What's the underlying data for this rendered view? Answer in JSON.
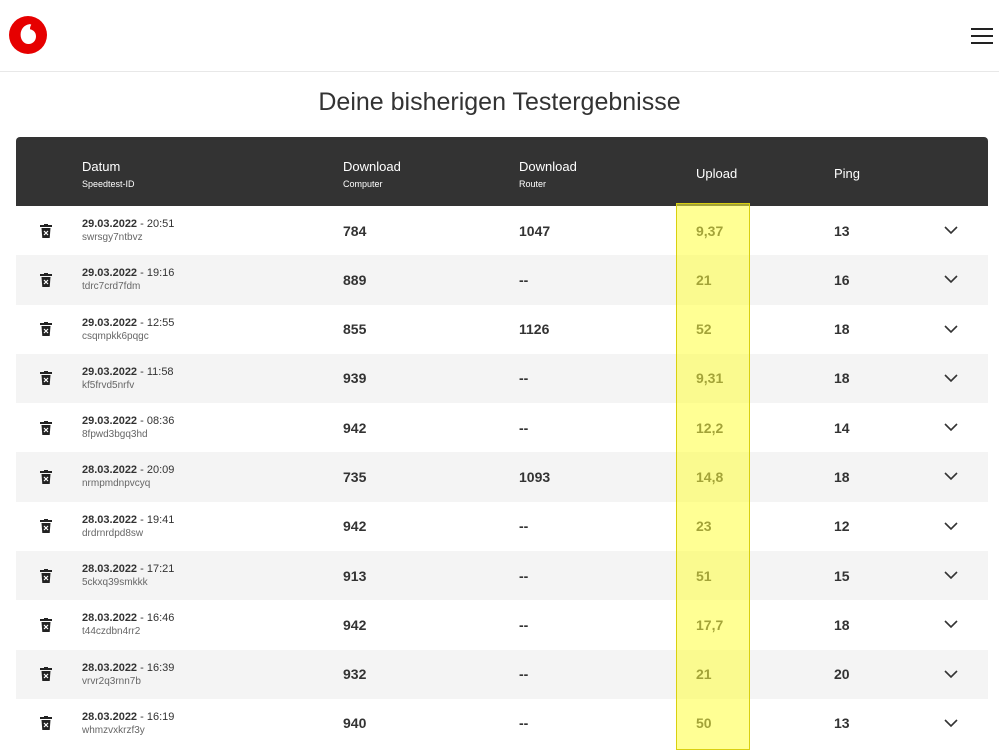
{
  "app": {
    "logo_icon": "vodafone-logo-icon",
    "brand_color": "#e60000",
    "menu_icon": "hamburger-menu-icon"
  },
  "page": {
    "title": "Deine bisherigen Testergebnisse"
  },
  "table": {
    "header": {
      "date": "Datum",
      "date_sub": "Speedtest-ID",
      "download_computer": "Download",
      "download_computer_sub": "Computer",
      "download_router": "Download",
      "download_router_sub": "Router",
      "upload": "Upload",
      "ping": "Ping"
    },
    "rows": [
      {
        "date": "29.03.2022",
        "time": " - 20:51",
        "id": "swrsgy7ntbvz",
        "download": "784",
        "router": "1047",
        "upload": "9,37",
        "ping": "13"
      },
      {
        "date": "29.03.2022",
        "time": " - 19:16",
        "id": "tdrc7crd7fdm",
        "download": "889",
        "router": "--",
        "upload": "21",
        "ping": "16"
      },
      {
        "date": "29.03.2022",
        "time": " - 12:55",
        "id": "csqmpkk6pqgc",
        "download": "855",
        "router": "1126",
        "upload": "52",
        "ping": "18"
      },
      {
        "date": "29.03.2022",
        "time": " - 11:58",
        "id": "kf5frvd5nrfv",
        "download": "939",
        "router": "--",
        "upload": "9,31",
        "ping": "18"
      },
      {
        "date": "29.03.2022",
        "time": " - 08:36",
        "id": "8fpwd3bgq3hd",
        "download": "942",
        "router": "--",
        "upload": "12,2",
        "ping": "14"
      },
      {
        "date": "28.03.2022",
        "time": " - 20:09",
        "id": "nrmpmdnpvcyq",
        "download": "735",
        "router": "1093",
        "upload": "14,8",
        "ping": "18"
      },
      {
        "date": "28.03.2022",
        "time": " - 19:41",
        "id": "drdrnrdpd8sw",
        "download": "942",
        "router": "--",
        "upload": "23",
        "ping": "12"
      },
      {
        "date": "28.03.2022",
        "time": " - 17:21",
        "id": "5ckxq39smkkk",
        "download": "913",
        "router": "--",
        "upload": "51",
        "ping": "15"
      },
      {
        "date": "28.03.2022",
        "time": " - 16:46",
        "id": "t44czdbn4rr2",
        "download": "942",
        "router": "--",
        "upload": "17,7",
        "ping": "18"
      },
      {
        "date": "28.03.2022",
        "time": " - 16:39",
        "id": "vrvr2q3rnn7b",
        "download": "932",
        "router": "--",
        "upload": "21",
        "ping": "20"
      },
      {
        "date": "28.03.2022",
        "time": " - 16:19",
        "id": "whmzvxkrzf3y",
        "download": "940",
        "router": "--",
        "upload": "50",
        "ping": "13"
      }
    ],
    "row_delete_icon": "trash-icon",
    "row_expand_icon": "chevron-down-icon",
    "highlight_color": "#ffff3c"
  }
}
